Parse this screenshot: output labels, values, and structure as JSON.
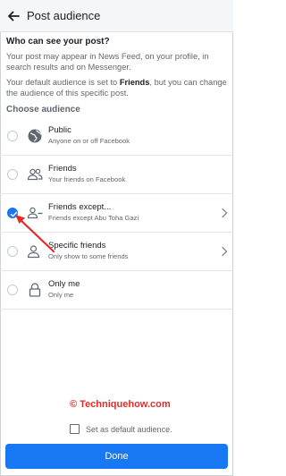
{
  "header": {
    "title": "Post audience"
  },
  "question": "Who can see your post?",
  "info1": "Your post may appear in News Feed, on your profile, in search results and on Messenger.",
  "info2_pre": "Your default audience is set to ",
  "info2_bold": "Friends",
  "info2_post": ", but you can change the audience of this specific post.",
  "choose_label": "Choose audience",
  "options": [
    {
      "title": "Public",
      "subtitle": "Anyone on or off Facebook",
      "icon": "globe-icon",
      "selected": false,
      "has_chevron": false
    },
    {
      "title": "Friends",
      "subtitle": "Your friends on Facebook",
      "icon": "friends-icon",
      "selected": false,
      "has_chevron": false
    },
    {
      "title": "Friends except...",
      "subtitle": "Friends except Abu Toha Gazi",
      "icon": "friends-except-icon",
      "selected": true,
      "has_chevron": true
    },
    {
      "title": "Specific friends",
      "subtitle": "Only show to some friends",
      "icon": "specific-friends-icon",
      "selected": false,
      "has_chevron": true
    },
    {
      "title": "Only me",
      "subtitle": "Only me",
      "icon": "lock-icon",
      "selected": false,
      "has_chevron": false
    }
  ],
  "watermark": "© Techniquehow.com",
  "default_checkbox_label": "Set as default audience.",
  "done_label": "Done",
  "colors": {
    "accent": "#1877f2",
    "annotation": "#e22b2b"
  }
}
